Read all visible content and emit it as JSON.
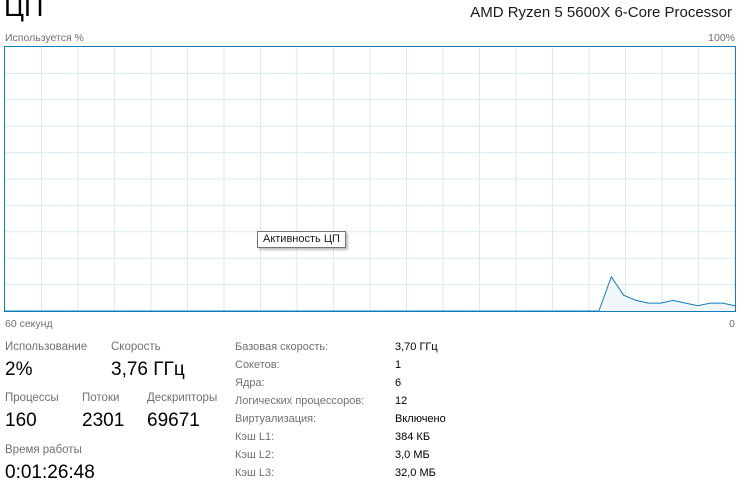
{
  "header": {
    "title": "ЦП",
    "cpu_model": "AMD Ryzen 5 5600X 6-Core Processor"
  },
  "graph": {
    "utilization_label": "Используется %",
    "max_label": "100%",
    "time_label": "60 секунд",
    "min_label": "0",
    "tooltip": "Активность ЦП",
    "line_color": "#117dbb",
    "grid_color": "#d9eaf4",
    "fill_color": "#f1f6fa",
    "utilization_history": [
      0,
      0,
      0,
      0,
      0,
      0,
      0,
      0,
      0,
      0,
      0,
      0,
      0,
      0,
      0,
      0,
      0,
      0,
      0,
      0,
      0,
      0,
      0,
      0,
      0,
      0,
      0,
      0,
      0,
      0,
      0,
      0,
      0,
      0,
      0,
      0,
      0,
      0,
      0,
      0,
      0,
      0,
      0,
      0,
      0,
      0,
      0,
      0,
      0,
      13,
      6,
      4,
      3,
      3,
      4,
      3,
      2,
      3,
      3,
      2
    ]
  },
  "stats": {
    "usage": {
      "label": "Использование",
      "value": "2%"
    },
    "speed": {
      "label": "Скорость",
      "value": "3,76 ГГц"
    },
    "processes": {
      "label": "Процессы",
      "value": "160"
    },
    "threads": {
      "label": "Потоки",
      "value": "2301"
    },
    "handles": {
      "label": "Дескрипторы",
      "value": "69671"
    },
    "uptime": {
      "label": "Время работы",
      "value": "0:01:26:48"
    }
  },
  "specs": [
    {
      "label": "Базовая скорость:",
      "value": "3,70 ГГц"
    },
    {
      "label": "Сокетов:",
      "value": "1"
    },
    {
      "label": "Ядра:",
      "value": "6"
    },
    {
      "label": "Логических процессоров:",
      "value": "12"
    },
    {
      "label": "Виртуализация:",
      "value": "Включено"
    },
    {
      "label": "Кэш L1:",
      "value": "384 КБ"
    },
    {
      "label": "Кэш L2:",
      "value": "3,0 МБ"
    },
    {
      "label": "Кэш L3:",
      "value": "32,0 МБ"
    }
  ]
}
